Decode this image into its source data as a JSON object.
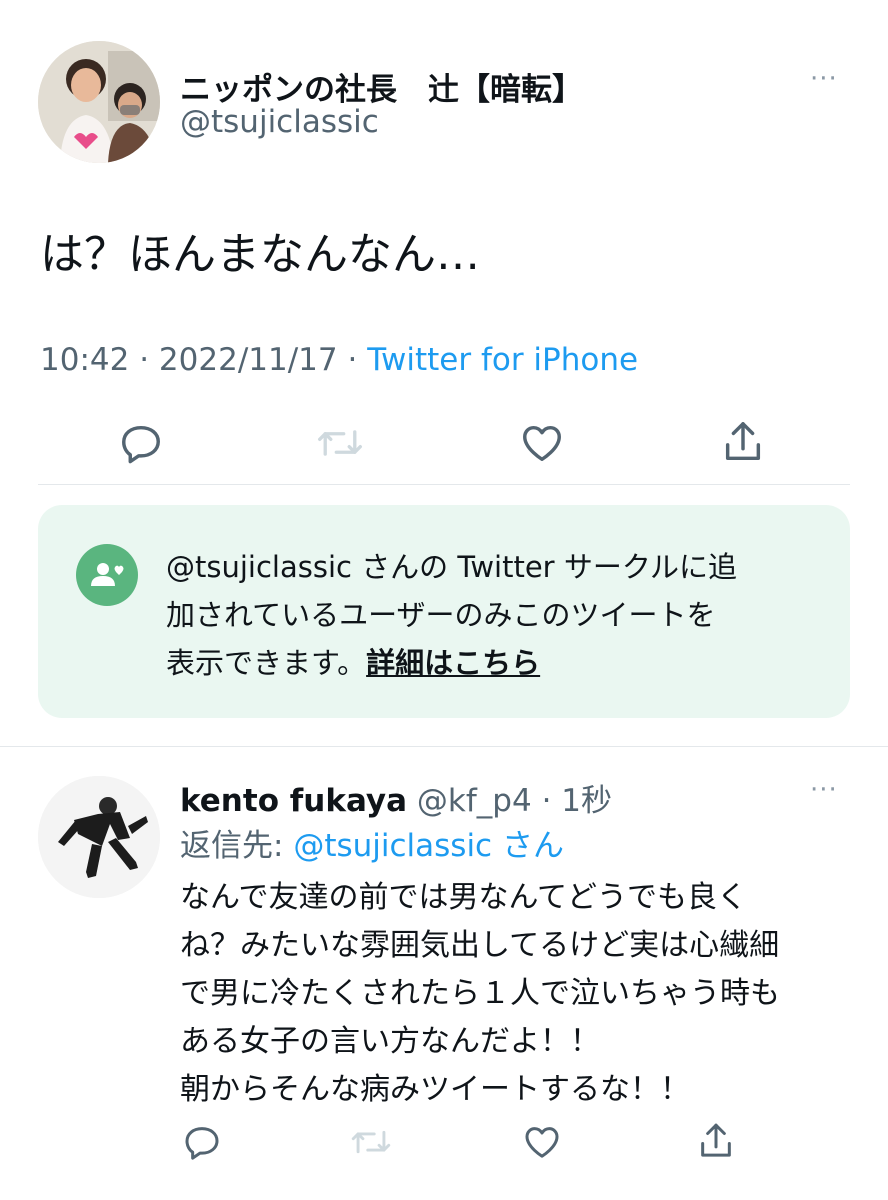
{
  "tweet": {
    "display_name": "ニッポンの社長　辻【暗転】",
    "handle": "@tsujiclassic",
    "text": "は？ほんまなんなん…",
    "time": "10:42",
    "sep1": "·",
    "date": "2022/11/17",
    "sep2": "·",
    "source": "Twitter for iPhone",
    "more_label": "···"
  },
  "circle_notice": {
    "line1": "@tsujiclassic さんの Twitter サークルに追",
    "line2": "加されているユーザーのみこのツイートを",
    "line3": "表示できます。",
    "link": "詳細はこちら",
    "bg_color": "#eaf7f1",
    "icon_color": "#5ab57f"
  },
  "reply": {
    "display_name": "kento fukaya",
    "handle": "@kf_p4",
    "sep": "·",
    "time": "1秒",
    "reply_to_prefix": "返信先:",
    "reply_to_handle": "@tsujiclassic",
    "reply_to_suffix": "さん",
    "lines": [
      "なんで友達の前では男なんてどうでも良く",
      "ね？みたいな雰囲気出してるけど実は心繊細",
      "で男に冷たくされたら１人で泣いちゃう時も",
      "ある女子の言い方なんだよ！！",
      "朝からそんな病みツイートするな！！"
    ],
    "more_label": "···"
  },
  "icons": [
    "reply-icon",
    "retweet-icon",
    "like-icon",
    "share-icon",
    "more-icon",
    "circle-people-icon"
  ],
  "colors": {
    "link": "#1d9bf0",
    "muted": "#536471",
    "icon": "#536471",
    "icon_disabled": "#cfd9de"
  }
}
